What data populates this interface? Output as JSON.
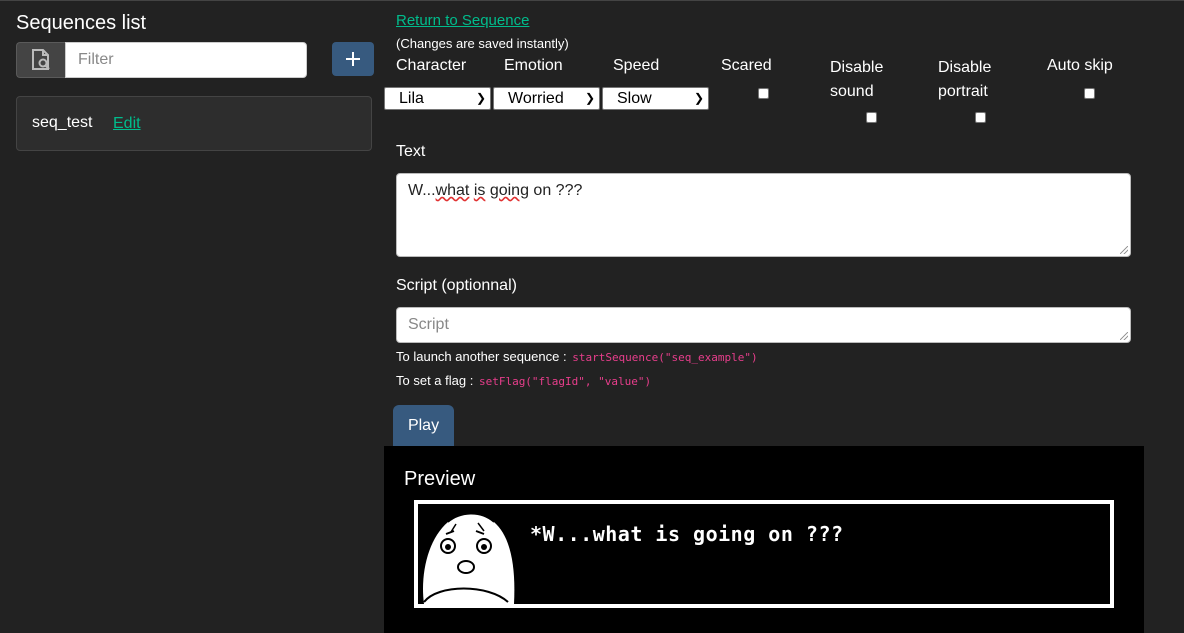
{
  "sidebar": {
    "title": "Sequences list",
    "filter_placeholder": "Filter",
    "add_label": "+",
    "sequences": [
      {
        "name": "seq_test",
        "edit_label": "Edit"
      }
    ]
  },
  "editor": {
    "return_link": "Return to Sequence",
    "saved_note": "(Changes are saved instantly)",
    "labels": {
      "character": "Character",
      "emotion": "Emotion",
      "speed": "Speed",
      "scared": "Scared",
      "disable_sound_1": "Disable",
      "disable_sound_2": "sound",
      "disable_portrait_1": "Disable",
      "disable_portrait_2": "portrait",
      "auto_skip": "Auto skip"
    },
    "selected": {
      "character": "Lila",
      "emotion": "Worried",
      "speed": "Slow"
    },
    "checkboxes": {
      "scared": false,
      "disable_sound": false,
      "disable_portrait": false,
      "auto_skip": false
    },
    "text_label": "Text",
    "text_value_parts": [
      "W...",
      "what",
      " ",
      "is",
      " ",
      "going",
      " on ???"
    ],
    "script_label": "Script (optionnal)",
    "script_placeholder": "Script",
    "hint_launch": "To launch another sequence :",
    "hint_launch_code": "startSequence(\"seq_example\")",
    "hint_flag": "To set a flag :",
    "hint_flag_code": "setFlag(\"flagId\", \"value\")",
    "play_label": "Play"
  },
  "preview": {
    "title": "Preview",
    "dialog_text": "*W...what is going on ???"
  }
}
